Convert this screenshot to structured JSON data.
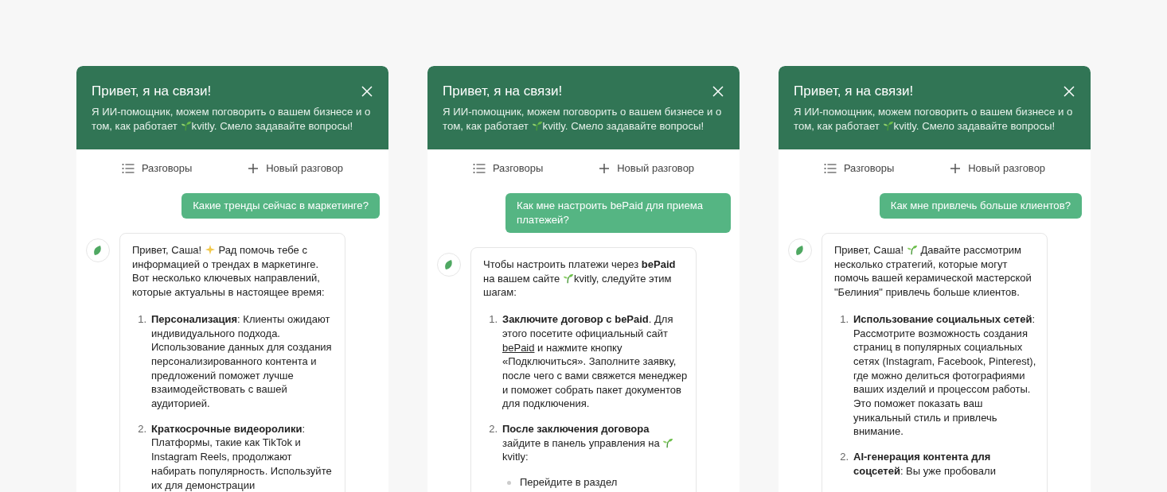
{
  "panels": [
    {
      "header": {
        "title": "Привет, я на связи!",
        "subtitle": [
          {
            "kind": "text",
            "text": "Я ИИ-помощник, можем поговорить о вашем бизнесе и о "
          },
          {
            "kind": "text",
            "text": "том, как работает "
          },
          {
            "kind": "sprout"
          },
          {
            "kind": "text",
            "text": "kvitly. Смело задавайте вопросы!"
          }
        ]
      },
      "nav": [
        {
          "kind": "list",
          "label": "Разговоры"
        },
        {
          "kind": "new",
          "label": "Новый разговор"
        }
      ],
      "user_message": "Какие тренды сейчас в маркетинге?",
      "bot_message": {
        "intro": [
          {
            "kind": "text",
            "text": "Привет, Саша! "
          },
          {
            "kind": "sparkle"
          },
          {
            "kind": "text",
            "text": " Рад помочь тебе с "
          },
          {
            "kind": "text",
            "text": "информацией о трендах в маркетинге. Вот несколько ключевых направлений, которые актуальны в настоящее время:"
          }
        ],
        "items": [
          {
            "number": "1.",
            "segments": [
              {
                "kind": "text",
                "text": "**Персонализация**: Клиенты ожидают индивидуального подхода. Использование данных для создания персонализированного контента и предложений поможет лучше взаимодействовать с вашей аудиторией."
              }
            ]
          },
          {
            "number": "2.",
            "segments": [
              {
                "kind": "text",
                "text": "**Краткосрочные видеоролики**: Платформы, такие как TikTok и Instagram Reels, продолжают набирать популярность. Используйте их для демонстрации"
              }
            ]
          }
        ]
      }
    },
    {
      "header": {
        "title": "Привет, я на связи!",
        "subtitle": [
          {
            "kind": "text",
            "text": "Я ИИ-помощник, можем поговорить о вашем бизнесе и о "
          },
          {
            "kind": "text",
            "text": "том, как работает "
          },
          {
            "kind": "sprout"
          },
          {
            "kind": "text",
            "text": "kvitly. Смело задавайте вопросы!"
          }
        ]
      },
      "nav": [
        {
          "kind": "list",
          "label": "Разговоры"
        },
        {
          "kind": "new",
          "label": "Новый разговор"
        }
      ],
      "user_message": "Как мне настроить bePaid для приема платежей?",
      "bot_message": {
        "intro": [
          {
            "kind": "text",
            "text": "Чтобы настроить платежи через **bePaid** "
          },
          {
            "kind": "text",
            "text": "на вашем сайте "
          },
          {
            "kind": "sprout"
          },
          {
            "kind": "text",
            "text": "kvitly, следуйте этим "
          },
          {
            "kind": "text",
            "text": "шагам:"
          }
        ],
        "items": [
          {
            "number": "1.",
            "segments": [
              {
                "kind": "text",
                "text": "**Заключите договор с bePaid**. Для этого посетите официальный сайт "
              },
              {
                "kind": "link",
                "text": "bePaid"
              },
              {
                "kind": "text",
                "text": " и нажмите кнопку "
              },
              {
                "kind": "text",
                "text": "«Подключиться». Заполните заявку, после чего с вами свяжется менеджер и поможет собрать пакет документов для подключения."
              }
            ]
          },
          {
            "number": "2.",
            "segments": [
              {
                "kind": "text",
                "text": "**После заключения договора** "
              },
              {
                "kind": "text",
                "text": "зайдите в панель управления на "
              },
              {
                "kind": "sprout"
              },
              {
                "kind": "text",
                "text": " kvitly:"
              }
            ],
            "sub_items": [
              "Перейдите в раздел"
            ]
          }
        ]
      }
    },
    {
      "header": {
        "title": "Привет, я на связи!",
        "subtitle": [
          {
            "kind": "text",
            "text": "Я ИИ-помощник, можем поговорить о вашем бизнесе и о "
          },
          {
            "kind": "text",
            "text": "том, как работает "
          },
          {
            "kind": "sprout"
          },
          {
            "kind": "text",
            "text": "kvitly. Смело задавайте вопросы!"
          }
        ]
      },
      "nav": [
        {
          "kind": "list",
          "label": "Разговоры"
        },
        {
          "kind": "new",
          "label": "Новый разговор"
        }
      ],
      "user_message": "Как мне привлечь больше клиентов?",
      "bot_message": {
        "intro": [
          {
            "kind": "text",
            "text": "Привет, Саша! "
          },
          {
            "kind": "sprout"
          },
          {
            "kind": "text",
            "text": " Давайте рассмотрим "
          },
          {
            "kind": "text",
            "text": "несколько стратегий, которые могут помочь вашей керамической мастерской \"Белиния\" привлечь больше клиентов."
          }
        ],
        "items": [
          {
            "number": "1.",
            "segments": [
              {
                "kind": "text",
                "text": "**Использование социальных сетей**: Рассмотрите возможность создания страниц в популярных социальных сетях (Instagram, Facebook, Pinterest), где можно делиться фотографиями ваших изделий и процессом работы. Это поможет показать ваш уникальный стиль и привлечь внимание."
              }
            ]
          },
          {
            "number": "2.",
            "segments": [
              {
                "kind": "text",
                "text": "**AI-генерация контента для соцсетей**: Вы уже пробовали"
              }
            ]
          }
        ]
      }
    }
  ]
}
